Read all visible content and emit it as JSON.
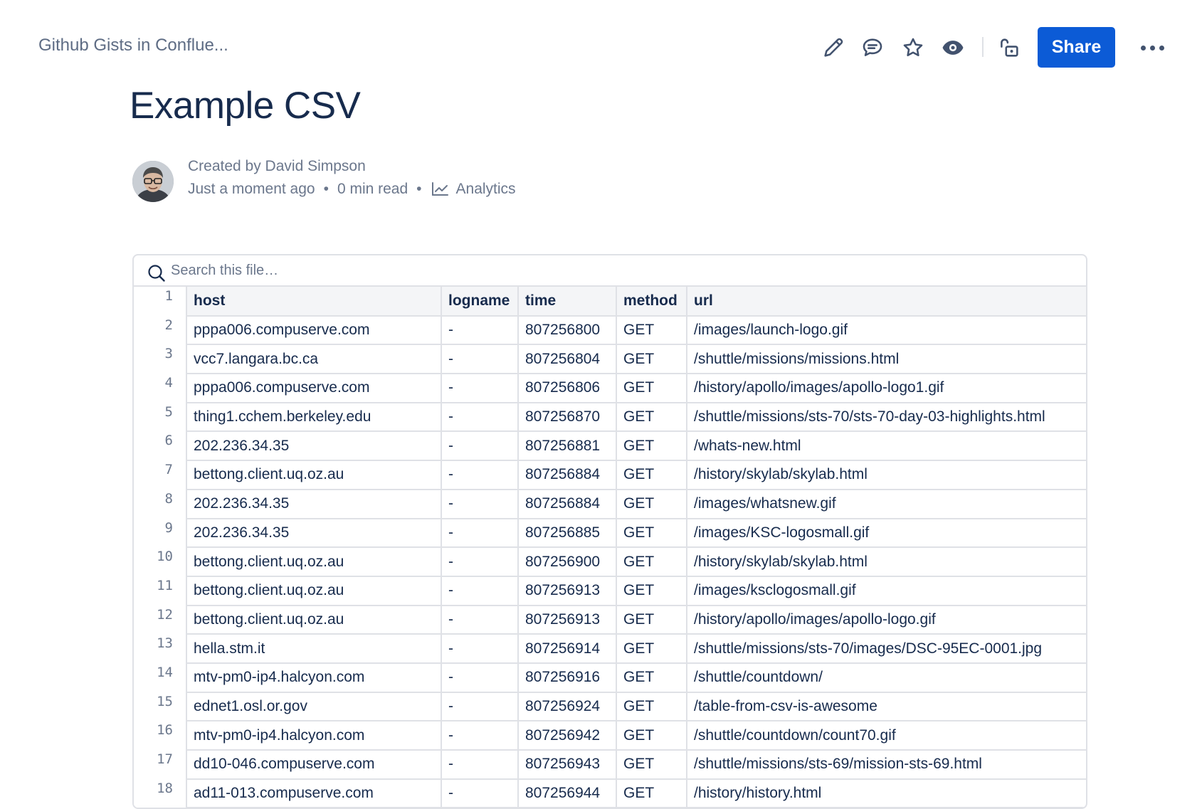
{
  "header": {
    "breadcrumb": "Github Gists in Conflue...",
    "share_label": "Share",
    "icons": [
      "pencil-icon",
      "comment-icon",
      "star-icon",
      "eye-icon",
      "unlock-icon",
      "more-icon"
    ],
    "accent": "#0c5bd6"
  },
  "page": {
    "title": "Example CSV",
    "created_by": "Created by David Simpson",
    "updated": "Just a moment ago",
    "read_time": "0 min read",
    "analytics": "Analytics"
  },
  "file": {
    "search_placeholder": "Search this file…",
    "headers": [
      "host",
      "logname",
      "time",
      "method",
      "url"
    ],
    "rows": [
      [
        "pppa006.compuserve.com",
        "-",
        "807256800",
        "GET",
        "/images/launch-logo.gif"
      ],
      [
        "vcc7.langara.bc.ca",
        "-",
        "807256804",
        "GET",
        "/shuttle/missions/missions.html"
      ],
      [
        "pppa006.compuserve.com",
        "-",
        "807256806",
        "GET",
        "/history/apollo/images/apollo-logo1.gif"
      ],
      [
        "thing1.cchem.berkeley.edu",
        "-",
        "807256870",
        "GET",
        "/shuttle/missions/sts-70/sts-70-day-03-highlights.html"
      ],
      [
        "202.236.34.35",
        "-",
        "807256881",
        "GET",
        "/whats-new.html"
      ],
      [
        "bettong.client.uq.oz.au",
        "-",
        "807256884",
        "GET",
        "/history/skylab/skylab.html"
      ],
      [
        "202.236.34.35",
        "-",
        "807256884",
        "GET",
        "/images/whatsnew.gif"
      ],
      [
        "202.236.34.35",
        "-",
        "807256885",
        "GET",
        "/images/KSC-logosmall.gif"
      ],
      [
        "bettong.client.uq.oz.au",
        "-",
        "807256900",
        "GET",
        "/history/skylab/skylab.html"
      ],
      [
        "bettong.client.uq.oz.au",
        "-",
        "807256913",
        "GET",
        "/images/ksclogosmall.gif"
      ],
      [
        "bettong.client.uq.oz.au",
        "-",
        "807256913",
        "GET",
        "/history/apollo/images/apollo-logo.gif"
      ],
      [
        "hella.stm.it",
        "-",
        "807256914",
        "GET",
        "/shuttle/missions/sts-70/images/DSC-95EC-0001.jpg"
      ],
      [
        "mtv-pm0-ip4.halcyon.com",
        "-",
        "807256916",
        "GET",
        "/shuttle/countdown/"
      ],
      [
        "ednet1.osl.or.gov",
        "-",
        "807256924",
        "GET",
        "/table-from-csv-is-awesome"
      ],
      [
        "mtv-pm0-ip4.halcyon.com",
        "-",
        "807256942",
        "GET",
        "/shuttle/countdown/count70.gif"
      ],
      [
        "dd10-046.compuserve.com",
        "-",
        "807256943",
        "GET",
        "/shuttle/missions/sts-69/mission-sts-69.html"
      ],
      [
        "ad11-013.compuserve.com",
        "-",
        "807256944",
        "GET",
        "/history/history.html"
      ]
    ]
  }
}
